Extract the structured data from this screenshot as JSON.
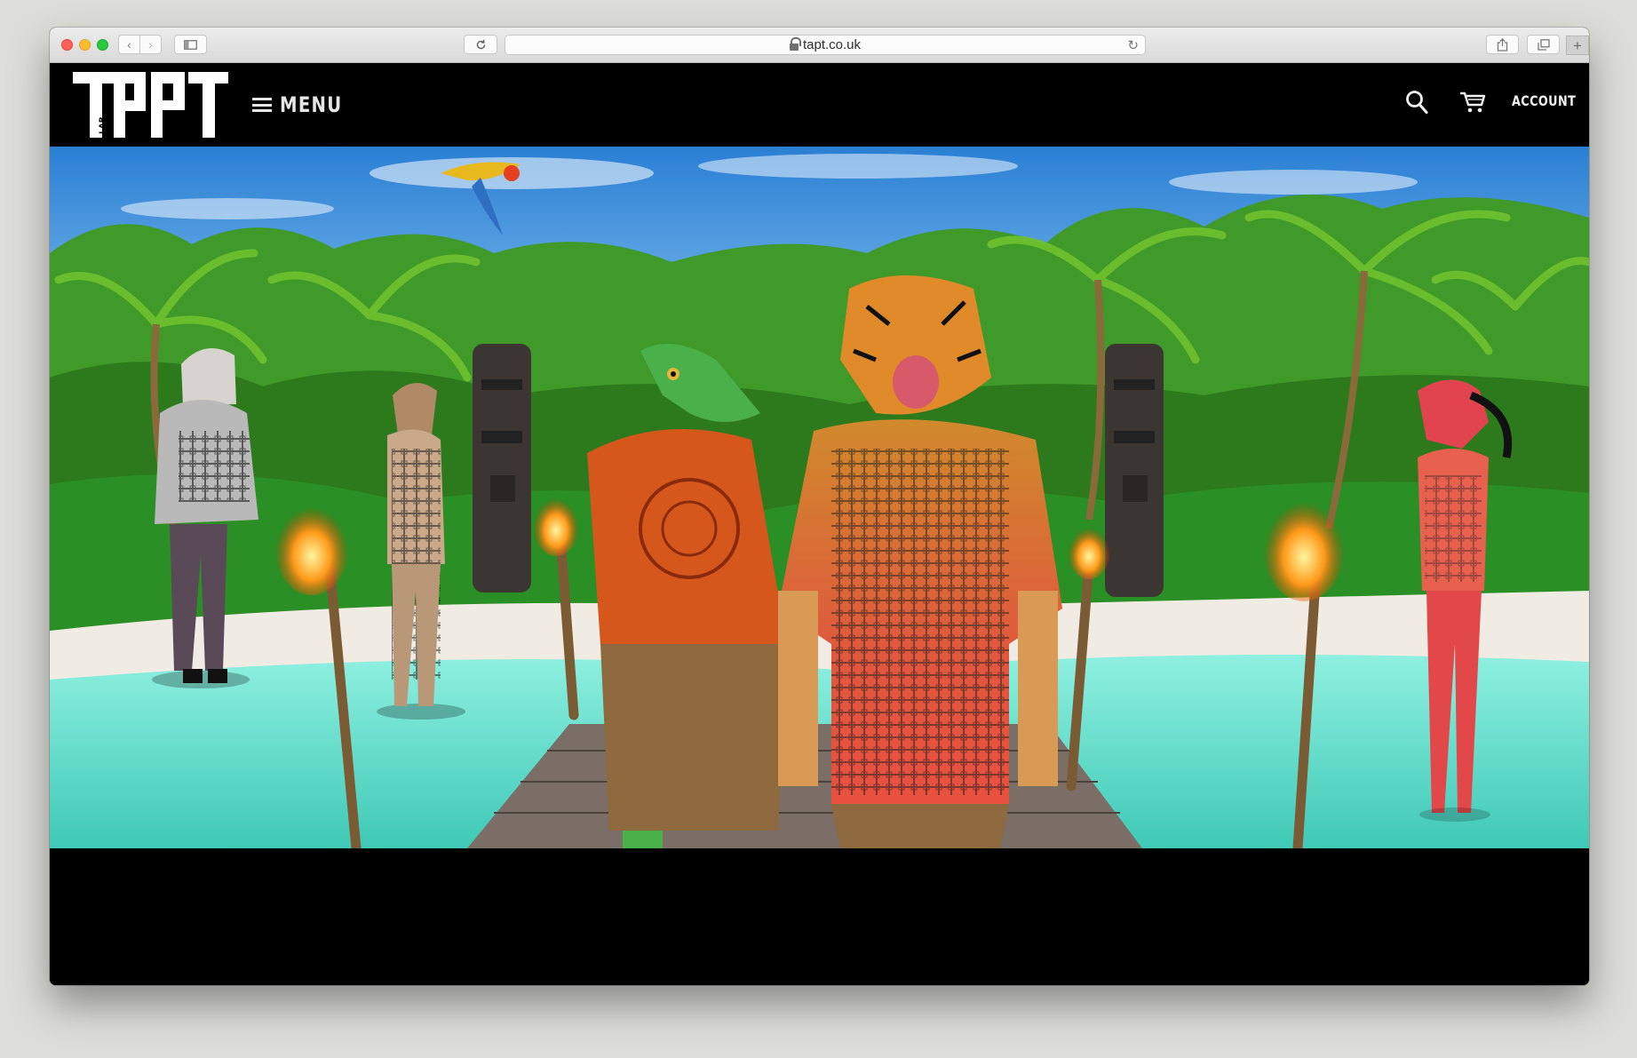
{
  "browser": {
    "url": "tapt.co.uk",
    "new_tab_symbol": "+"
  },
  "site": {
    "logo_text": "TAPT",
    "logo_small_text": "LAB",
    "menu_label": "MENU",
    "account_label": "ACCOUNT"
  },
  "hero": {
    "description_icons": [
      "palm-trees",
      "tiki-torch",
      "tiki-statue",
      "tiger-head-model",
      "lizard-head-model",
      "flamingo-head-model",
      "goat-head-model",
      "cat-head-model",
      "macaw",
      "jetty"
    ]
  },
  "colors": {
    "header_bg": "#000000",
    "sky": "#3b8fd8",
    "sea": "#5fdcc8",
    "sand": "#f1ece3"
  }
}
